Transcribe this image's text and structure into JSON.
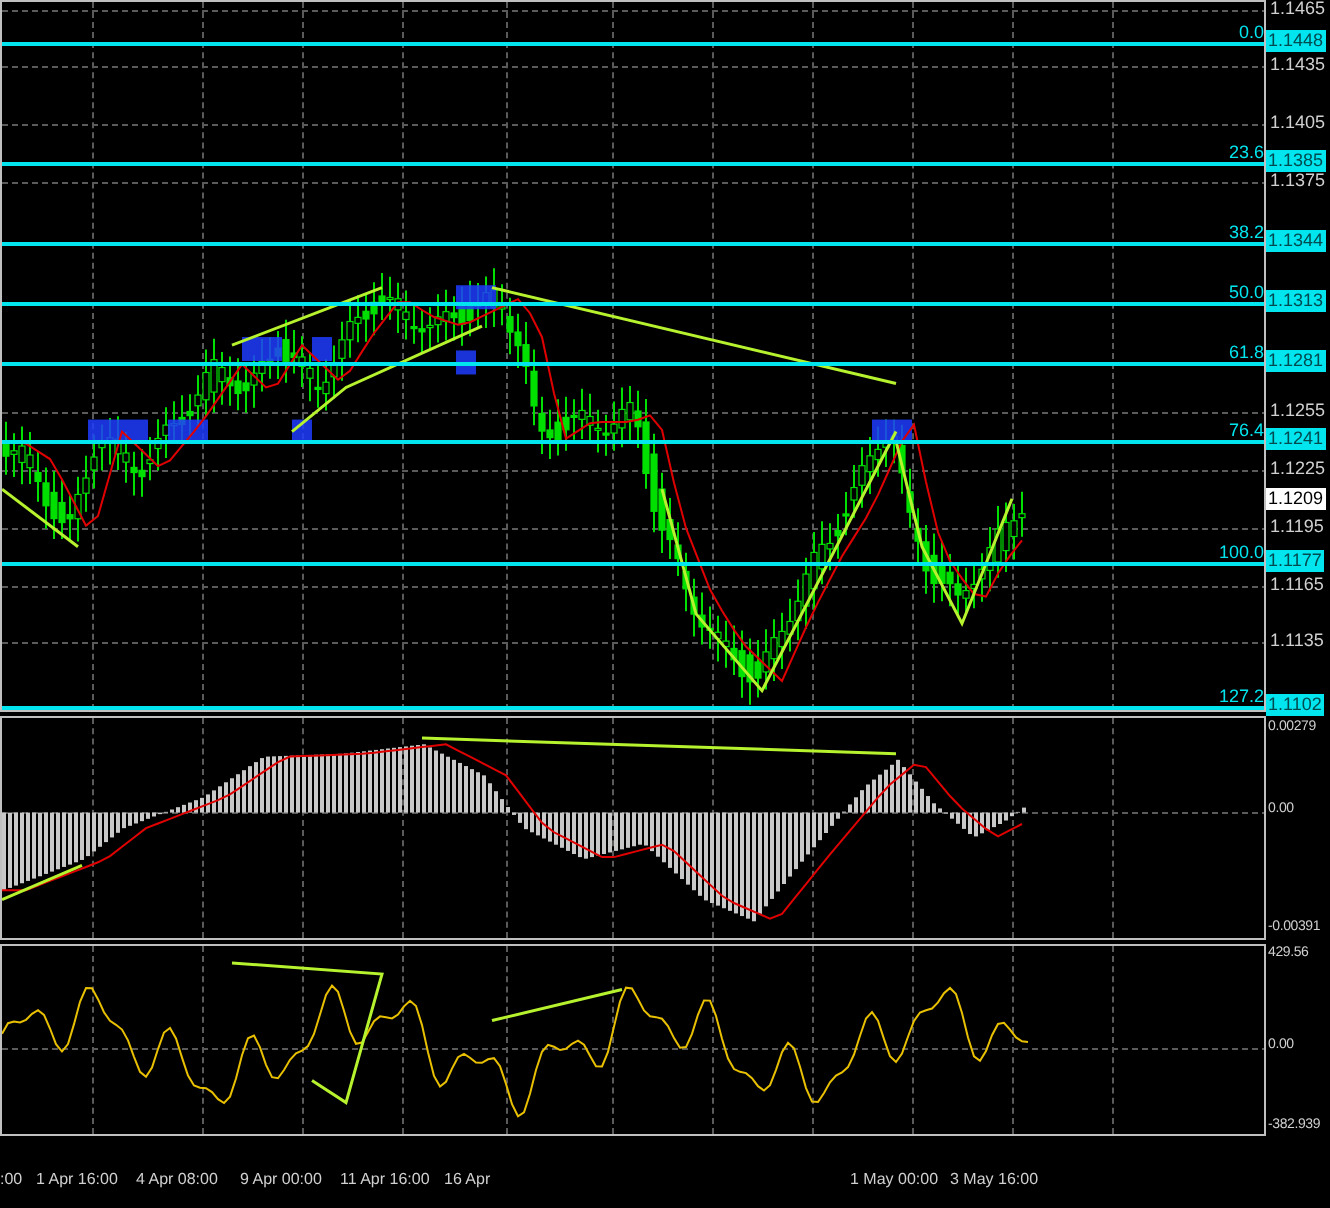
{
  "price_axis": {
    "ticks": [
      "1.1465",
      "1.1435",
      "1.1405",
      "1.1375",
      "1.1255",
      "1.1225",
      "1.1195",
      "1.1165",
      "1.1135"
    ],
    "current_price": "1.1209"
  },
  "fibonacci_levels": [
    {
      "ratio": "0.0",
      "price": "1.1448"
    },
    {
      "ratio": "23.6",
      "price": "1.1385"
    },
    {
      "ratio": "38.2",
      "price": "1.1344"
    },
    {
      "ratio": "50.0",
      "price": "1.1313"
    },
    {
      "ratio": "61.8",
      "price": "1.1281"
    },
    {
      "ratio": "76.4",
      "price": "1.1241"
    },
    {
      "ratio": "100.0",
      "price": "1.1177"
    },
    {
      "ratio": "127.2",
      "price": "1.1102"
    }
  ],
  "macd_panel": {
    "axis_labels": [
      "0.00279",
      "0.00",
      "-0.00391"
    ]
  },
  "oscillator_panel": {
    "axis_labels": [
      "429.56",
      "0.00",
      "-382.939"
    ]
  },
  "time_axis": {
    "labels": [
      ":00",
      "1 Apr 16:00",
      "4 Apr 08:00",
      "9 Apr 00:00",
      "11 Apr 16:00",
      "16 Apr",
      "1 May 00:00",
      "3 May 16:00"
    ]
  }
}
